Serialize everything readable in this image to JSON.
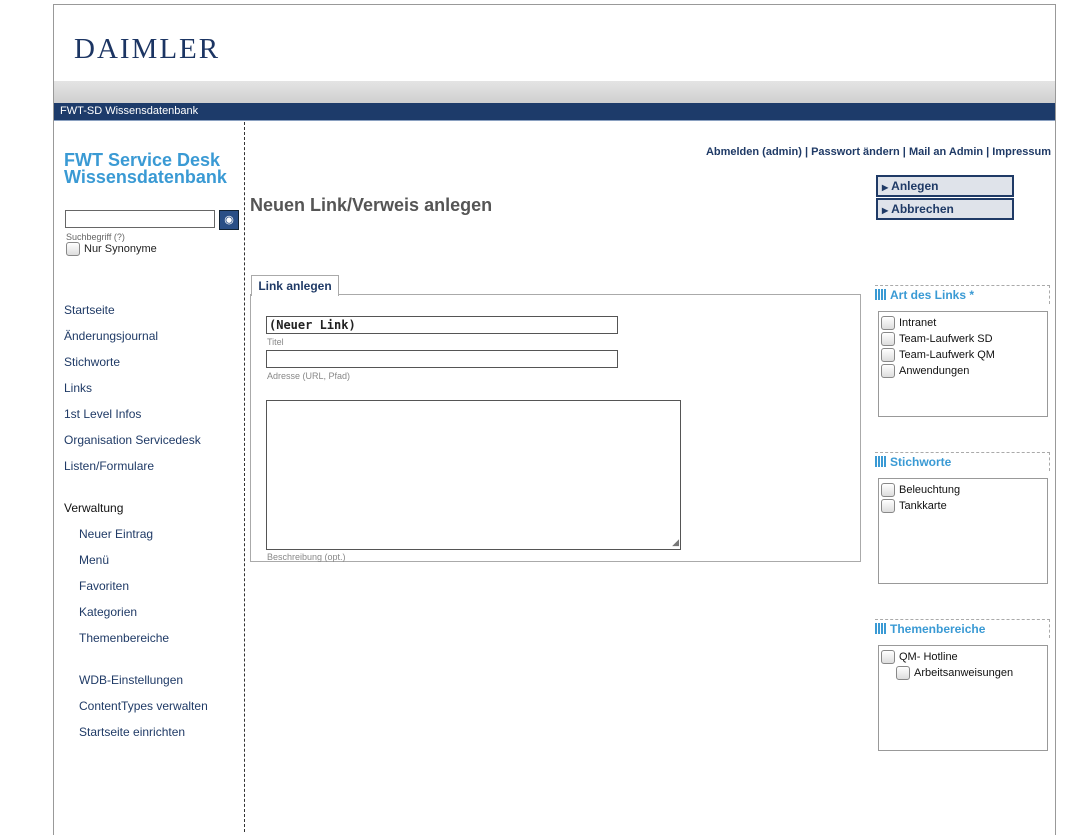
{
  "brand": {
    "logo": "DAIMLER",
    "bar_title": "FWT-SD Wissensdatenbank"
  },
  "sidebar": {
    "app_name_line1": "FWT Service Desk",
    "app_name_line2": "Wissensdatenbank",
    "search_placeholder": "",
    "search_hint": "Suchbegriff (?)",
    "only_synonyms": "Nur Synonyme",
    "nav": [
      "Startseite",
      "Änderungsjournal",
      "Stichworte",
      "Links",
      "1st Level Infos",
      "Organisation Servicedesk",
      "Listen/Formulare"
    ],
    "admin_header": "Verwaltung",
    "admin_items": [
      "Neuer Eintrag",
      "Menü",
      "Favoriten",
      "Kategorien",
      "Themenbereiche"
    ],
    "admin_items2": [
      "WDB-Einstellungen",
      "ContentTypes verwalten",
      "Startseite einrichten"
    ]
  },
  "toplinks": {
    "logout": "Abmelden (admin)",
    "password": "Passwort ändern",
    "mail": "Mail an Admin",
    "imprint": "Impressum",
    "sep": "|"
  },
  "actions": {
    "create": "Anlegen",
    "cancel": "Abbrechen"
  },
  "main": {
    "title": "Neuen Link/Verweis anlegen",
    "tab": "Link anlegen",
    "title_value": "(Neuer Link)",
    "title_label": "Titel",
    "address_value": "",
    "address_label": "Adresse (URL, Pfad)",
    "description_label": "Beschreibung (opt.)"
  },
  "panels": {
    "link_type": {
      "header": "Art des Links *",
      "items": [
        "Intranet",
        "Team-Laufwerk SD",
        "Team-Laufwerk QM",
        "Anwendungen"
      ]
    },
    "keywords": {
      "header": "Stichworte",
      "items": [
        "Beleuchtung",
        "Tankkarte"
      ]
    },
    "topics": {
      "header": "Themenbereiche",
      "items": [
        "QM- Hotline",
        "Arbeitsanweisungen"
      ]
    }
  },
  "colors": {
    "brand_navy": "#1c3563",
    "bar_blue": "#1d3b6a",
    "accent_cyan": "#3a9ad4"
  }
}
